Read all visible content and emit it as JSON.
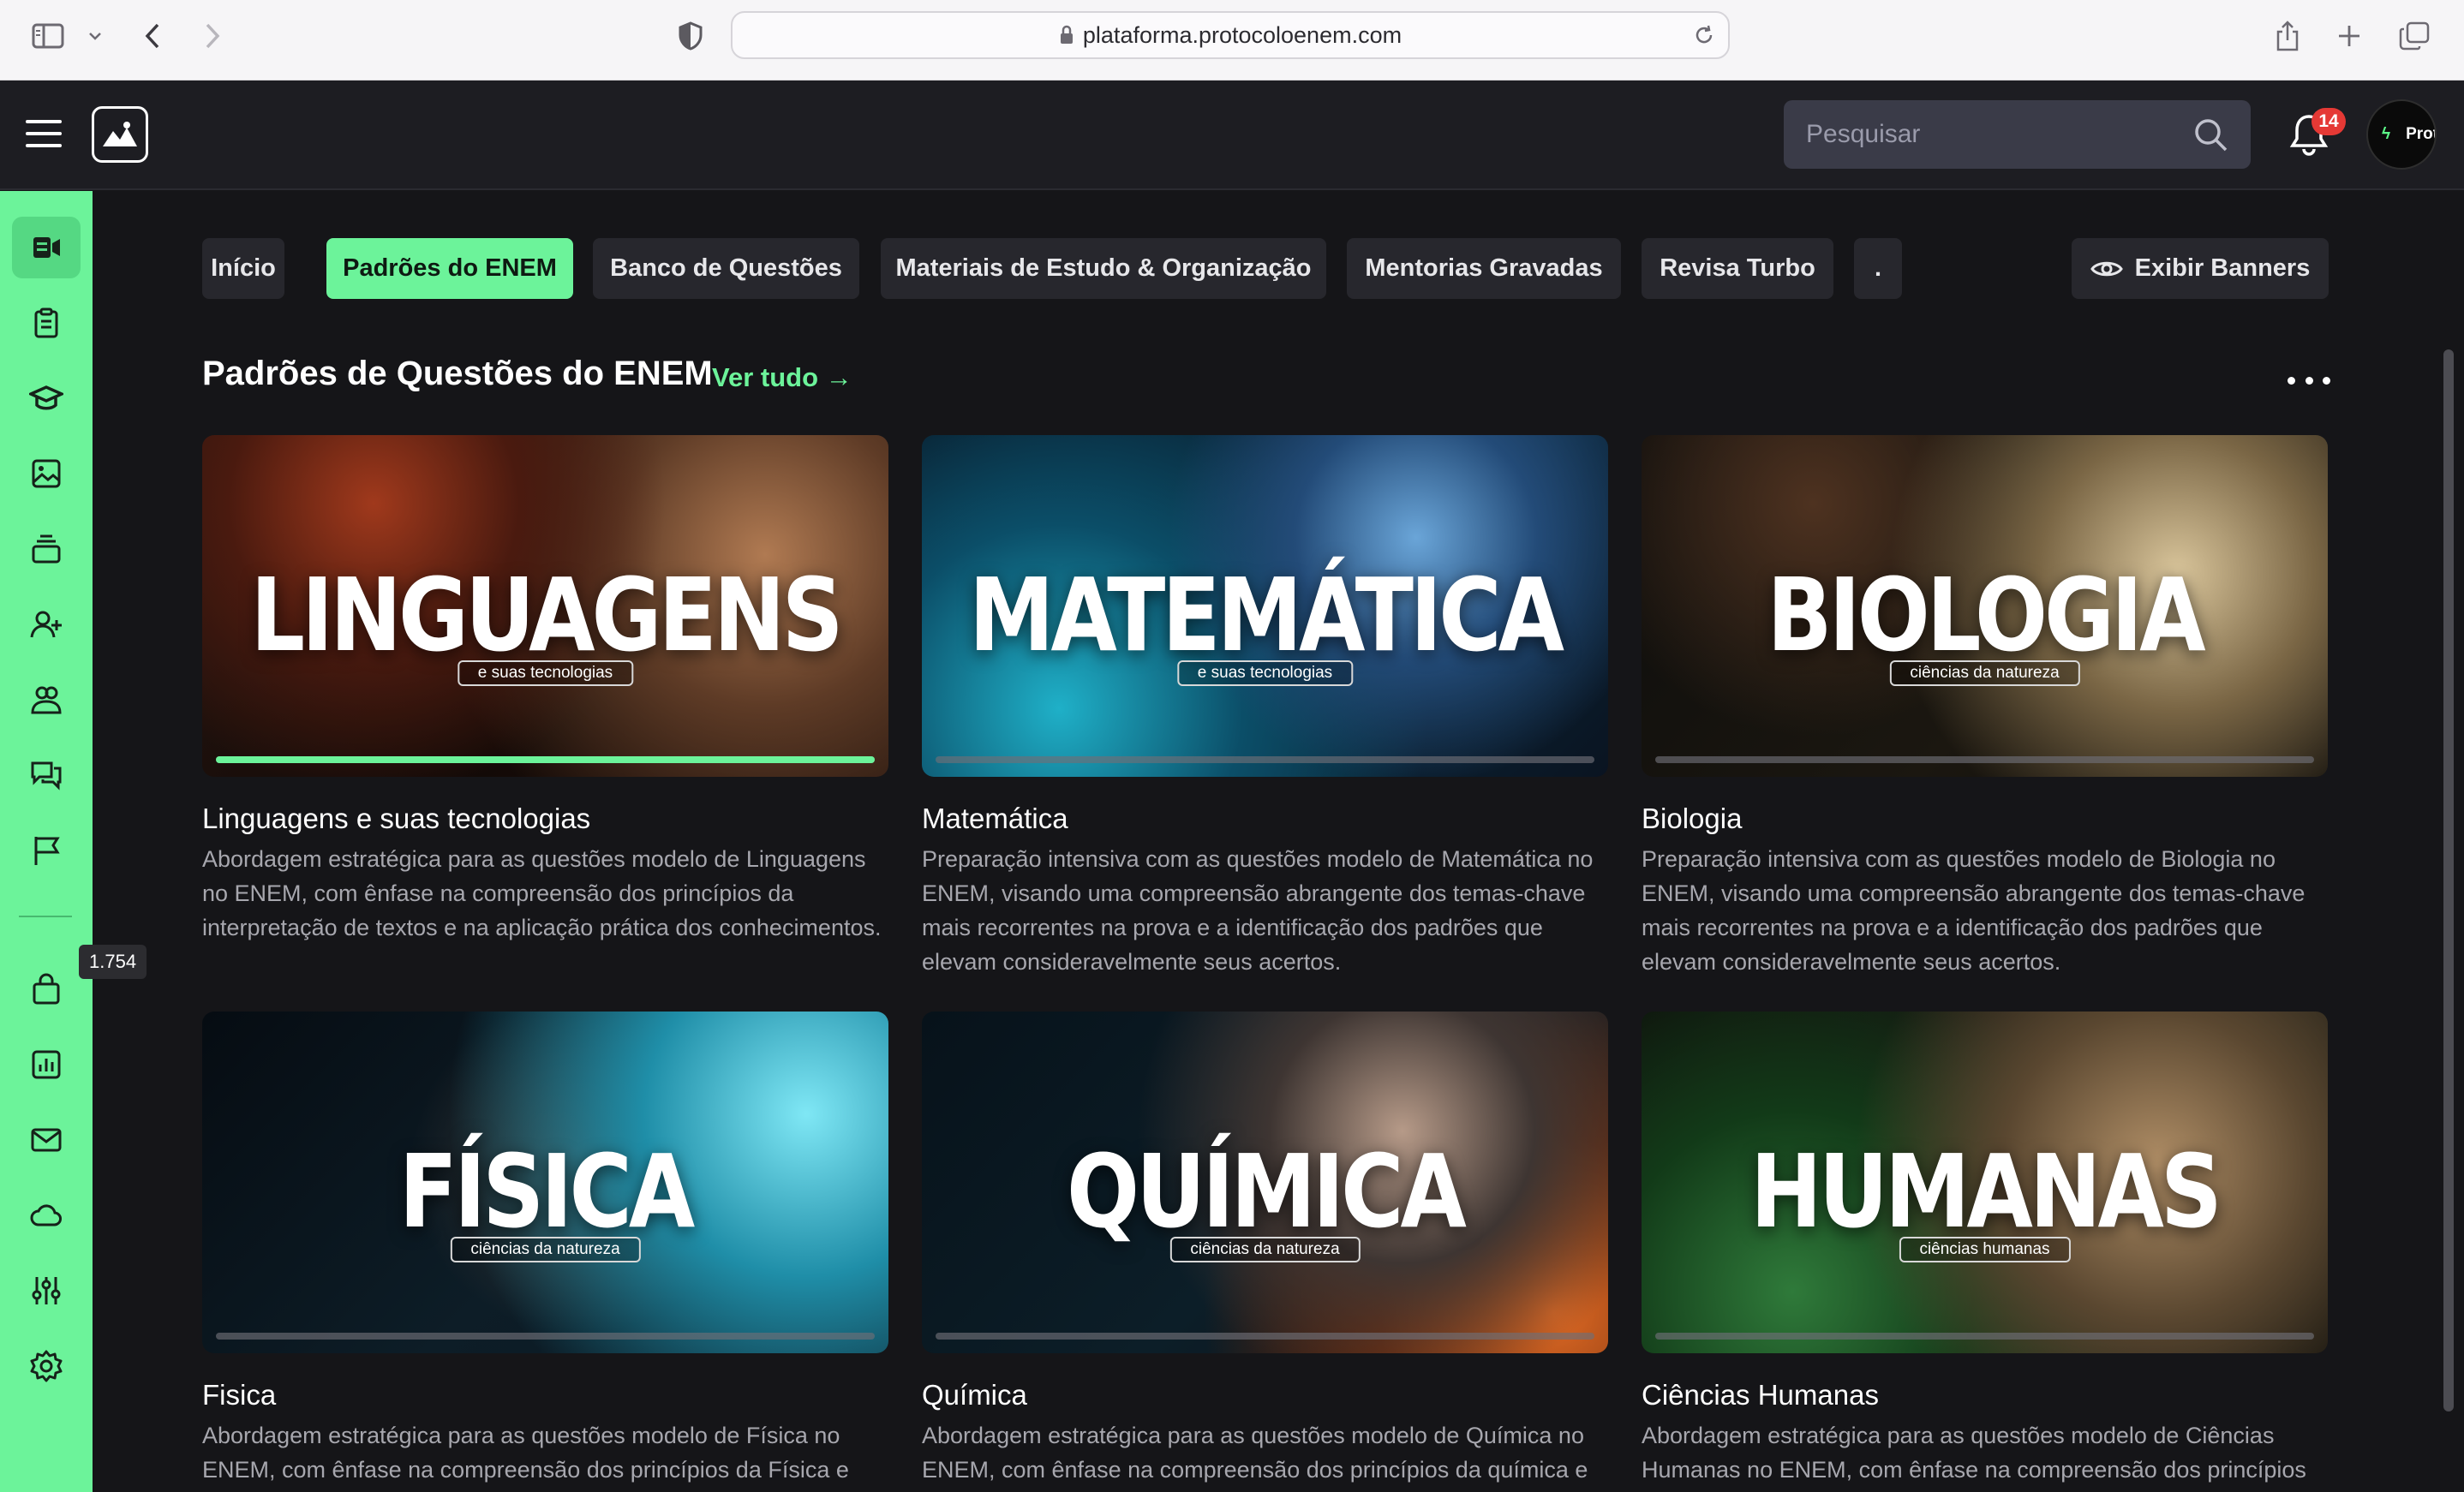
{
  "browser": {
    "url": "plataforma.protocoloenem.com",
    "icons": [
      "sidebar-toggle-icon",
      "chevron-down-icon",
      "back-icon",
      "forward-icon",
      "shield-icon",
      "lock-icon",
      "reload-icon",
      "share-icon",
      "new-tab-icon",
      "tabs-overview-icon"
    ]
  },
  "header": {
    "search_placeholder": "Pesquisar",
    "notification_count": "14",
    "avatar_text": "Protoc"
  },
  "sidebar": {
    "accent_color": "#6cf39a",
    "items": [
      {
        "icon": "courses-icon",
        "active": true
      },
      {
        "icon": "clipboard-icon"
      },
      {
        "icon": "graduation-cap-icon"
      },
      {
        "icon": "image-icon"
      },
      {
        "icon": "stack-icon"
      },
      {
        "icon": "add-user-icon"
      },
      {
        "icon": "users-icon"
      },
      {
        "icon": "chat-icon"
      },
      {
        "icon": "flag-icon"
      },
      {
        "icon": "shopping-bag-icon"
      },
      {
        "icon": "chart-icon"
      },
      {
        "icon": "mail-icon"
      },
      {
        "icon": "cloud-icon"
      },
      {
        "icon": "sliders-icon"
      },
      {
        "icon": "settings-icon"
      }
    ],
    "tooltip": "1.754"
  },
  "tabs": [
    {
      "label": "Início"
    },
    {
      "label": "Padrões do ENEM",
      "active": true
    },
    {
      "label": "Banco de Questões"
    },
    {
      "label": "Materiais de Estudo & Organização"
    },
    {
      "label": "Mentorias Gravadas"
    },
    {
      "label": "Revisa Turbo"
    },
    {
      "label": "."
    }
  ],
  "banner_button": "Exibir Banners",
  "section": {
    "title": "Padrões de Questões do ENEM",
    "see_all": "Ver tudo →"
  },
  "cards": [
    {
      "thumb_word": "LINGUAGENS",
      "thumb_tag": "e suas tecnologias",
      "progress": 1.0,
      "title": "Linguagens e suas tecnologias",
      "description": "Abordagem estratégica para as questões modelo de Linguagens no ENEM, com ênfase na compreensão dos princípios da interpretação de textos e na aplicação prática dos conhecimentos."
    },
    {
      "thumb_word": "MATEMÁTICA",
      "thumb_tag": "e suas tecnologias",
      "progress": 0.0,
      "title": "Matemática",
      "description": "Preparação intensiva com as questões modelo de Matemática no ENEM, visando uma compreensão abrangente dos temas-chave mais recorrentes na prova e a identificação dos padrões que elevam consideravelmente seus acertos."
    },
    {
      "thumb_word": "BIOLOGIA",
      "thumb_tag": "ciências da natureza",
      "progress": 0.0,
      "title": "Biologia",
      "description": "Preparação intensiva com as questões modelo de Biologia no ENEM, visando uma compreensão abrangente dos temas-chave mais recorrentes na prova e a identificação dos padrões que elevam consideravelmente seus acertos."
    },
    {
      "thumb_word": "FÍSICA",
      "thumb_tag": "ciências da natureza",
      "progress": 0.0,
      "title": "Fisica",
      "description": "Abordagem estratégica para as questões modelo de Física no ENEM, com ênfase na compreensão dos princípios da Física e"
    },
    {
      "thumb_word": "QUÍMICA",
      "thumb_tag": "ciências da natureza",
      "progress": 0.0,
      "title": "Química",
      "description": "Abordagem estratégica para as questões modelo de Química no ENEM, com ênfase na compreensão dos princípios da química e"
    },
    {
      "thumb_word": "HUMANAS",
      "thumb_tag": "ciências humanas",
      "progress": 0.0,
      "title": "Ciências Humanas",
      "description": "Abordagem estratégica para as questões modelo de Ciências Humanas no ENEM, com ênfase na compreensão dos princípios"
    }
  ]
}
